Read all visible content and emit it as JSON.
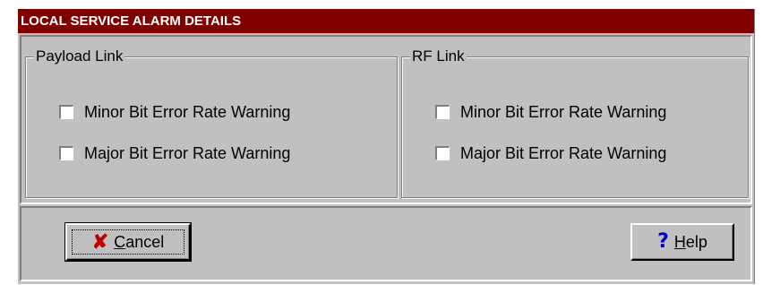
{
  "window": {
    "title": "LOCAL SERVICE ALARM DETAILS"
  },
  "groups": [
    {
      "title": "Payload Link",
      "checkboxes": [
        {
          "label": "Minor Bit Error Rate Warning",
          "checked": false
        },
        {
          "label": "Major Bit Error Rate Warning",
          "checked": false
        }
      ]
    },
    {
      "title": "RF Link",
      "checkboxes": [
        {
          "label": "Minor Bit Error Rate Warning",
          "checked": false
        },
        {
          "label": "Major Bit Error Rate Warning",
          "checked": false
        }
      ]
    }
  ],
  "buttons": {
    "cancel": {
      "label": "Cancel",
      "icon": "x-icon",
      "mnemonic": "C"
    },
    "help": {
      "label": "Help",
      "icon": "question-icon",
      "mnemonic": "H"
    }
  },
  "colors": {
    "titlebar": "#800000",
    "dialog_bg": "#c0c0c0",
    "cancel_icon": "#c00000",
    "help_icon": "#0000c8"
  }
}
